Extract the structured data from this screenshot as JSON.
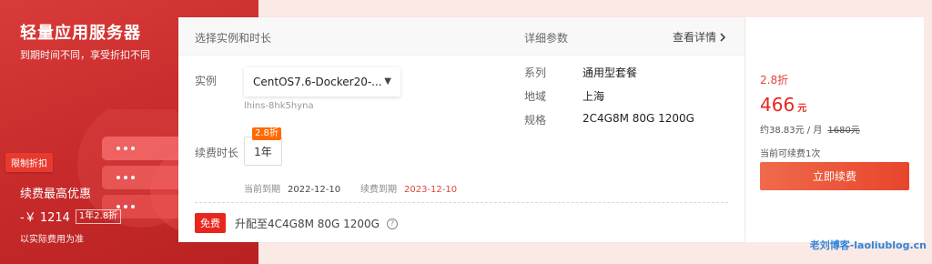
{
  "promo": {
    "title": "轻量应用服务器",
    "subtitle": "到期时间不同，享受折扣不同",
    "tag": "限制折扣",
    "save_label": "续费最高优惠",
    "save_amount": "-￥ 1214",
    "save_badge": "1年2.8折",
    "note": "以实际费用为准"
  },
  "header": {
    "left": "选择实例和时长",
    "mid": "详细参数",
    "link": "查看详情"
  },
  "instance": {
    "label": "实例",
    "selected": "CentOS7.6-Docker20-...",
    "id": "lhins-8hk5hyna"
  },
  "details": [
    {
      "key": "系列",
      "value": "通用型套餐"
    },
    {
      "key": "地域",
      "value": "上海"
    },
    {
      "key": "规格",
      "value": "2C4G8M 80G 1200G"
    }
  ],
  "duration": {
    "label": "续费时长",
    "option": "1年",
    "badge": "2.8折"
  },
  "expiry": {
    "current_label": "当前到期",
    "current_value": "2022-12-10",
    "renew_label": "续费到期",
    "renew_value": "2023-12-10"
  },
  "upgrade": {
    "badge": "免费",
    "text": "升配至4C4G8M 80G 1200G"
  },
  "price": {
    "discount": "2.8折",
    "amount": "466",
    "unit": "元",
    "per_month": "约38.83元 / 月",
    "original": "1680元",
    "renew_count": "当前可续费1次",
    "button": "立即续费"
  },
  "watermark": "老刘博客-laoliublog.cn",
  "colors": {
    "accent": "#e8261e",
    "promo_bg": "#c72a2a",
    "discount_badge": "#ff6a00"
  }
}
